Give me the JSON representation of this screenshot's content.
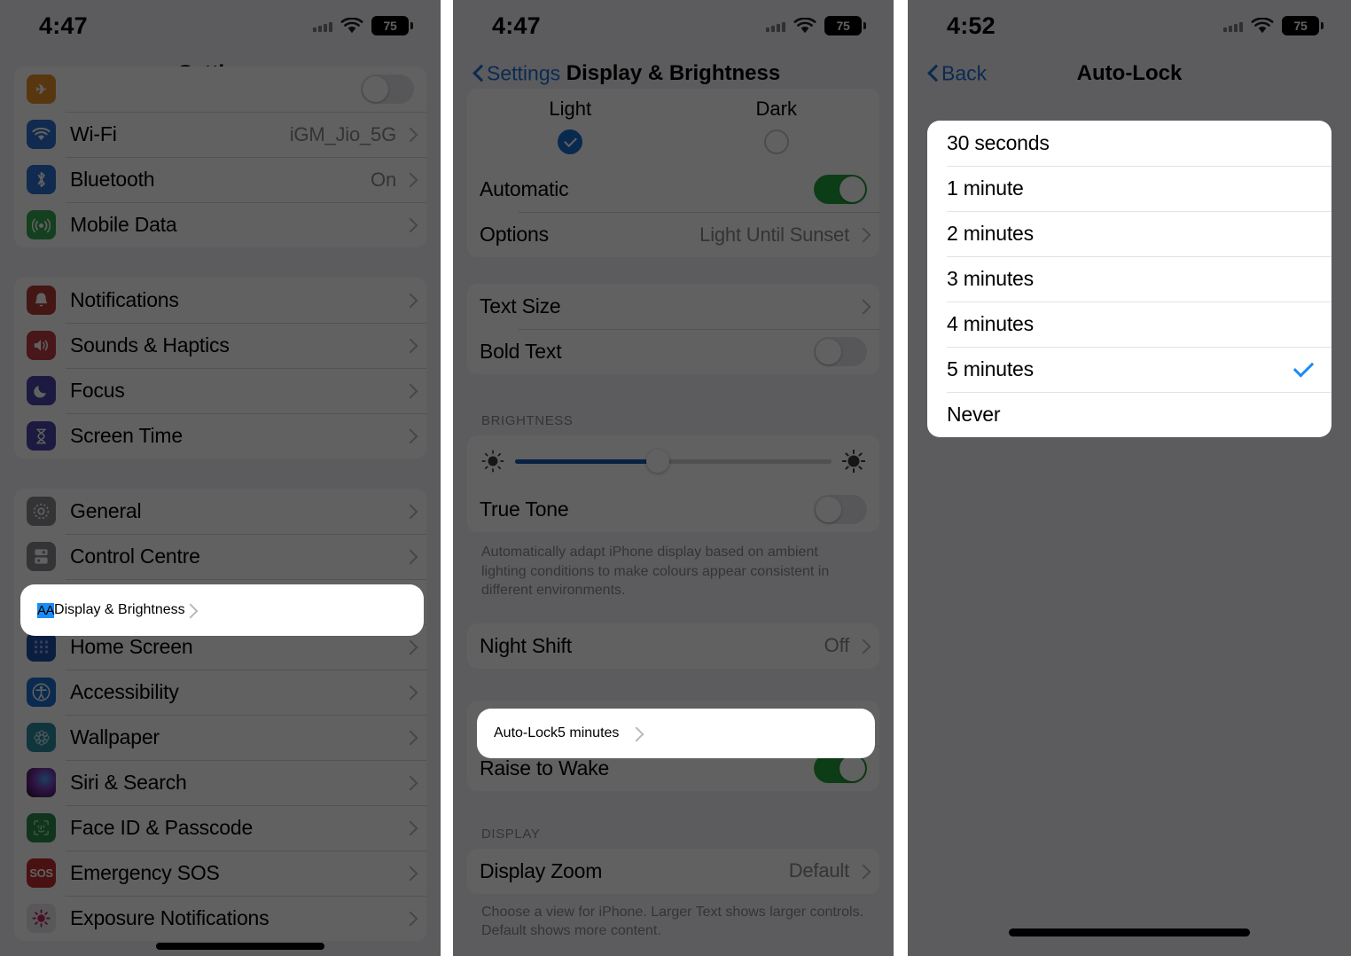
{
  "theme": {
    "accent_blue": "#1b8cf5",
    "link_blue": "#1f6fd6",
    "toggle_green": "#23a13b",
    "slider_blue": "#1559b0",
    "dim_overlay": "rgba(0,0,0,0.62)",
    "panel_bg": "#f2f2f7"
  },
  "panel1": {
    "status": {
      "time": "4:47",
      "battery": "75",
      "wifi_icon": "wifi-icon",
      "signal_icon": "cellular-signal-icon"
    },
    "nav": {
      "title": "Settings"
    },
    "group_top": [
      {
        "label": "Wi-Fi",
        "value": "iGM_Jio_5G",
        "icon": "wifi-icon",
        "icon_class": "ic-wifi",
        "glyph": "●"
      },
      {
        "label": "Bluetooth",
        "value": "On",
        "icon": "bluetooth-icon",
        "icon_class": "ic-bt",
        "glyph": "ᛦ"
      },
      {
        "label": "Mobile Data",
        "value": "",
        "icon": "cellular-icon",
        "icon_class": "ic-cell",
        "glyph": "((·))"
      }
    ],
    "group_two": [
      {
        "label": "Notifications",
        "value": "",
        "icon": "bell-icon",
        "icon_class": "ic-notif",
        "glyph": "ὑ4"
      },
      {
        "label": "Sounds & Haptics",
        "value": "",
        "icon": "speaker-icon",
        "icon_class": "ic-sound",
        "glyph": "ὐA"
      },
      {
        "label": "Focus",
        "value": "",
        "icon": "moon-icon",
        "icon_class": "ic-focus",
        "glyph": "☽"
      },
      {
        "label": "Screen Time",
        "value": "",
        "icon": "hourglass-icon",
        "icon_class": "ic-screentime",
        "glyph": "⌛"
      }
    ],
    "group_three": [
      {
        "label": "General",
        "value": "",
        "icon": "gear-icon",
        "icon_class": "ic-general",
        "glyph": "⚙"
      },
      {
        "label": "Control Centre",
        "value": "",
        "icon": "control-centre-icon",
        "icon_class": "ic-control",
        "glyph": "☰"
      },
      {
        "label": "Display & Brightness",
        "value": "",
        "icon": "display-brightness-icon",
        "icon_class": "ic-display",
        "glyph": "AA",
        "highlighted": true
      },
      {
        "label": "Home Screen",
        "value": "",
        "icon": "home-screen-icon",
        "icon_class": "ic-home",
        "glyph": "⌸"
      },
      {
        "label": "Accessibility",
        "value": "",
        "icon": "accessibility-icon",
        "icon_class": "ic-access",
        "glyph": "⛹"
      },
      {
        "label": "Wallpaper",
        "value": "",
        "icon": "wallpaper-icon",
        "icon_class": "ic-wall",
        "glyph": "❀"
      },
      {
        "label": "Siri & Search",
        "value": "",
        "icon": "siri-icon",
        "icon_class": "ic-siri",
        "glyph": ""
      },
      {
        "label": "Face ID & Passcode",
        "value": "",
        "icon": "face-id-icon",
        "icon_class": "ic-faceid",
        "glyph": "☺"
      },
      {
        "label": "Emergency SOS",
        "value": "",
        "icon": "sos-icon",
        "icon_class": "ic-sos",
        "glyph": "SOS"
      },
      {
        "label": "Exposure Notifications",
        "value": "",
        "icon": "exposure-notifications-icon",
        "icon_class": "ic-exposure",
        "glyph": "✹"
      }
    ]
  },
  "panel2": {
    "status": {
      "time": "4:47",
      "battery": "75"
    },
    "nav": {
      "back_label": "Settings",
      "title": "Display & Brightness"
    },
    "appearance": {
      "light_label": "Light",
      "dark_label": "Dark",
      "selected": "Light"
    },
    "automatic": {
      "label": "Automatic",
      "state": "on"
    },
    "options_row": {
      "label": "Options",
      "value": "Light Until Sunset"
    },
    "text_size": {
      "label": "Text Size"
    },
    "bold_text": {
      "label": "Bold Text",
      "state": "off"
    },
    "brightness": {
      "header": "BRIGHTNESS",
      "value_percent": 45,
      "low_icon": "brightness-low-icon",
      "high_icon": "brightness-high-icon"
    },
    "true_tone": {
      "label": "True Tone",
      "state": "off"
    },
    "true_tone_footer": "Automatically adapt iPhone display based on ambient lighting conditions to make colours appear consistent in different environments.",
    "night_shift": {
      "label": "Night Shift",
      "value": "Off"
    },
    "auto_lock": {
      "label": "Auto-Lock",
      "value": "5 minutes",
      "highlighted": true
    },
    "raise_to_wake": {
      "label": "Raise to Wake",
      "state": "on"
    },
    "display_header": "DISPLAY",
    "display_zoom": {
      "label": "Display Zoom",
      "value": "Default"
    },
    "display_footer": "Choose a view for iPhone. Larger Text shows larger controls. Default shows more content."
  },
  "panel3": {
    "status": {
      "time": "4:52",
      "battery": "75"
    },
    "nav": {
      "back_label": "Back",
      "title": "Auto-Lock"
    },
    "options": [
      {
        "label": "30 seconds",
        "selected": false
      },
      {
        "label": "1 minute",
        "selected": false
      },
      {
        "label": "2 minutes",
        "selected": false
      },
      {
        "label": "3 minutes",
        "selected": false
      },
      {
        "label": "4 minutes",
        "selected": false
      },
      {
        "label": "5 minutes",
        "selected": true
      },
      {
        "label": "Never",
        "selected": false
      }
    ]
  }
}
